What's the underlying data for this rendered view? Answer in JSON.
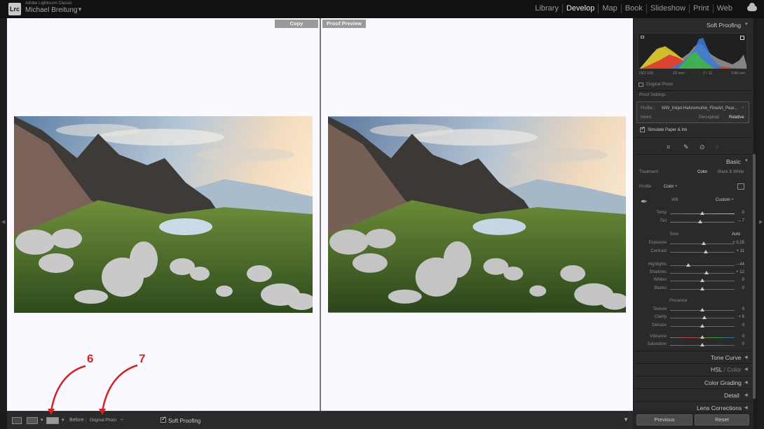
{
  "app": {
    "logo": "Lrc",
    "name": "Adobe Lightroom Classic",
    "user": "Michael Breitung",
    "user_chevron": "▼"
  },
  "modules": [
    "Library",
    "Develop",
    "Map",
    "Book",
    "Slideshow",
    "Print",
    "Web"
  ],
  "active_module": "Develop",
  "panes": {
    "left_label": "Copy",
    "right_label": "Proof Preview"
  },
  "toolbar": {
    "view_separator": "▾",
    "before_label": "Before :",
    "before_value": "Original Photo",
    "before_chevron": "÷",
    "soft_proofing": "Soft Proofing",
    "menu_chevron": "▼"
  },
  "edges": {
    "left_arrow": "◀",
    "right_arrow": "▶"
  },
  "panel": {
    "soft_proofing_title": "Soft Proofing",
    "collapse_arrow": "▼",
    "histogram": {
      "iso": "ISO 100",
      "focal": "23 mm",
      "aperture": "ƒ / 11",
      "shutter": "1/40 sec"
    },
    "original_photo": "Original Photo",
    "proof_settings": "Proof Settings :",
    "profile_label": "Profile :",
    "profile_value": "WW_Inkjet-Hahnemuhle_FineArt_Pear...",
    "profile_chevron": "÷",
    "intent_label": "Intent",
    "intent_perceptual": "Perceptual",
    "intent_relative": "Relative",
    "simulate": "Simulate Paper & Ink",
    "basic": {
      "title": "Basic",
      "treatment_label": "Treatment",
      "treatment_color": "Color",
      "treatment_bw": "Black & White",
      "profile_label": "Profile",
      "profile_value": "Color ÷",
      "wb_label": "WB",
      "wb_value": "Custom ÷",
      "tone_label": "Tone",
      "auto_label": "Auto",
      "presence_label": "Presence",
      "sliders": [
        {
          "label": "Temp",
          "value": "0",
          "pos": 0.5
        },
        {
          "label": "Tint",
          "value": "– 7",
          "pos": 0.47
        },
        {
          "label": "Exposure",
          "value": "+ 0,15",
          "pos": 0.52
        },
        {
          "label": "Contrast",
          "value": "+ 11",
          "pos": 0.55
        },
        {
          "label": "Highlights",
          "value": "– 44",
          "pos": 0.28
        },
        {
          "label": "Shadows",
          "value": "+ 12",
          "pos": 0.56
        },
        {
          "label": "Whites",
          "value": "0",
          "pos": 0.5
        },
        {
          "label": "Blacks",
          "value": "0",
          "pos": 0.5
        },
        {
          "label": "Texture",
          "value": "0",
          "pos": 0.5
        },
        {
          "label": "Clarity",
          "value": "+ 6",
          "pos": 0.53
        },
        {
          "label": "Dehaze",
          "value": "0",
          "pos": 0.5
        },
        {
          "label": "Vibrance",
          "value": "0",
          "pos": 0.5
        },
        {
          "label": "Saturation",
          "value": "0",
          "pos": 0.5
        }
      ]
    },
    "sections": [
      {
        "label": "Tone Curve",
        "arrow": "◀"
      },
      {
        "label_main": "HSL",
        "label_sep": " / ",
        "label_alt": "Color",
        "arrow": "◀"
      },
      {
        "label": "Color Grading",
        "arrow": "◀"
      },
      {
        "label": "Detail",
        "arrow": "◀"
      },
      {
        "label": "Lens Corrections",
        "arrow": "◀"
      }
    ],
    "previous": "Previous",
    "reset": "Reset"
  },
  "annotations": {
    "six": "6",
    "seven": "7"
  },
  "colors": {
    "annotation": "#d22222",
    "background": "#1a1a1a",
    "panel": "#2a2a2a"
  }
}
